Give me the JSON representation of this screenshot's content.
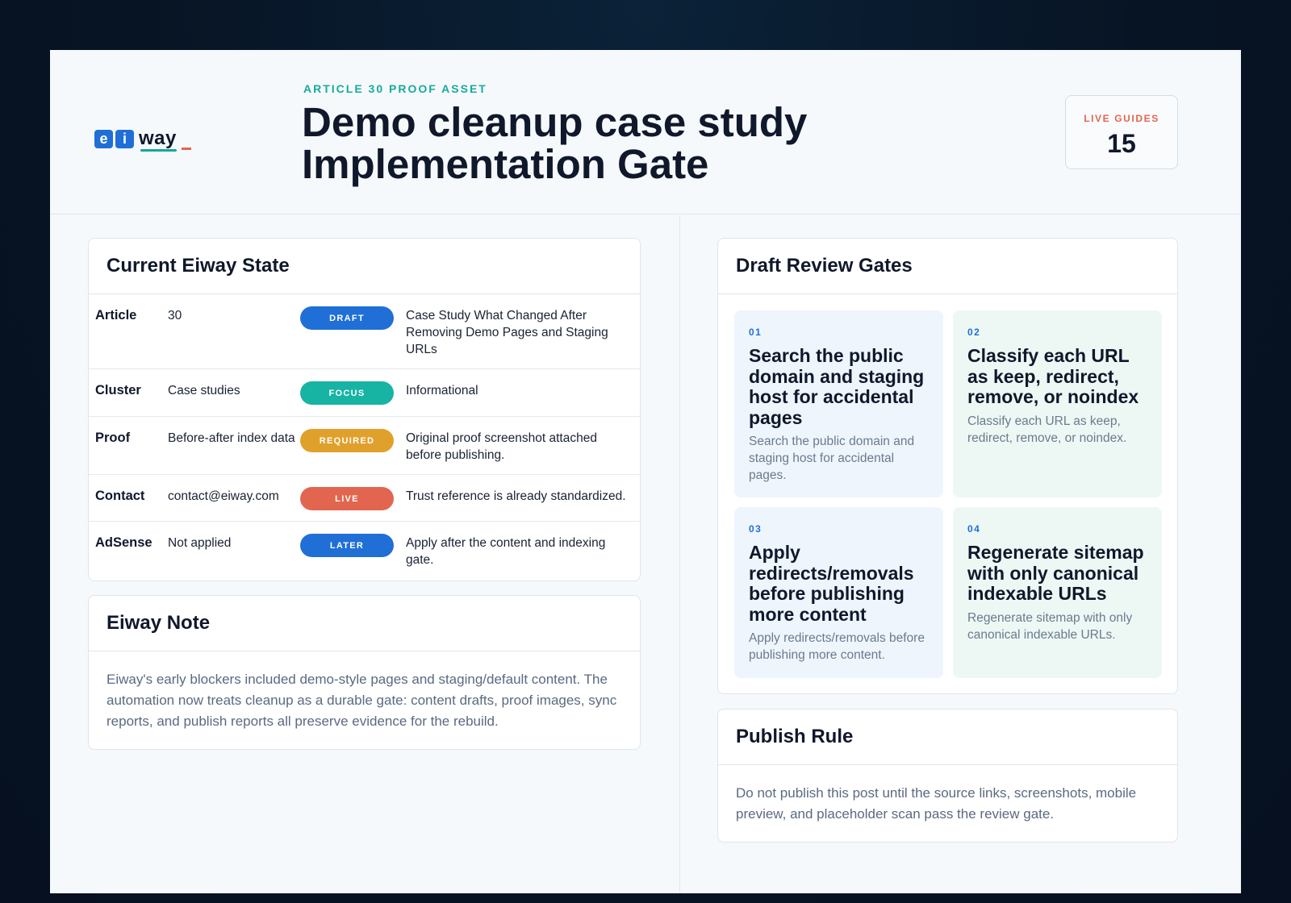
{
  "header": {
    "logo_tiles": [
      "e",
      "i"
    ],
    "logo_word": "way",
    "eyebrow": "ARTICLE 30 PROOF ASSET",
    "title_line1": "Demo cleanup case study",
    "title_line2": "Implementation Gate",
    "stat_label": "LIVE GUIDES",
    "stat_value": "15"
  },
  "state": {
    "heading": "Current Eiway State",
    "rows": [
      {
        "key": "Article",
        "value": "30",
        "badge": "DRAFT",
        "badge_color": "#1f6fd6",
        "detail": "Case Study What Changed After Removing Demo Pages and Staging URLs"
      },
      {
        "key": "Cluster",
        "value": "Case studies",
        "badge": "FOCUS",
        "badge_color": "#17b3a3",
        "detail": "Informational"
      },
      {
        "key": "Proof",
        "value": "Before-after index data",
        "badge": "REQUIRED",
        "badge_color": "#e0a02c",
        "detail": "Original proof screenshot attached before publishing."
      },
      {
        "key": "Contact",
        "value": "contact@eiway.com",
        "badge": "LIVE",
        "badge_color": "#e2664f",
        "detail": "Trust reference is already standardized."
      },
      {
        "key": "AdSense",
        "value": "Not applied",
        "badge": "LATER",
        "badge_color": "#1f6fd6",
        "detail": "Apply after the content and indexing gate."
      }
    ]
  },
  "note": {
    "heading": "Eiway Note",
    "body": "Eiway's early blockers included demo-style pages and staging/default content. The automation now treats cleanup as a durable gate: content drafts, proof images, sync reports, and publish reports all preserve evidence for the rebuild."
  },
  "gates": {
    "heading": "Draft Review Gates",
    "items": [
      {
        "num": "01",
        "title": "Search the public domain and staging host for accidental pages",
        "desc": "Search the public domain and staging host for accidental pages."
      },
      {
        "num": "02",
        "title": "Classify each URL as keep, redirect, remove, or noindex",
        "desc": "Classify each URL as keep, redirect, remove, or noindex."
      },
      {
        "num": "03",
        "title": "Apply redirects/removals before publishing more content",
        "desc": "Apply redirects/removals before publishing more content."
      },
      {
        "num": "04",
        "title": "Regenerate sitemap with only canonical indexable URLs",
        "desc": "Regenerate sitemap with only canonical indexable URLs."
      }
    ]
  },
  "rule": {
    "heading": "Publish Rule",
    "body": "Do not publish this post until the source links, screenshots, mobile preview, and placeholder scan pass the review gate."
  },
  "colors": {
    "accent_teal": "#17ab9c",
    "accent_blue": "#1f6fd6",
    "accent_coral": "#e2664f"
  }
}
